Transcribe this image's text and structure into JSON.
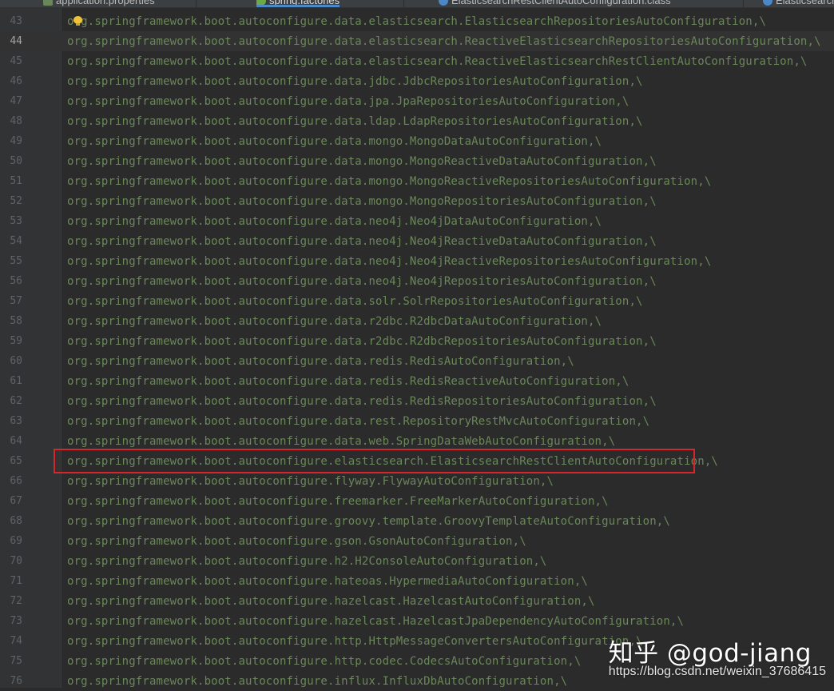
{
  "tabs": [
    {
      "label": "application.properties",
      "icon": "properties-file-icon",
      "active": false
    },
    {
      "label": "spring.factories",
      "icon": "spring-file-icon",
      "active": true
    },
    {
      "label": "ElasticsearchRestClientAutoConfiguration.class",
      "icon": "class-file-icon",
      "active": false
    },
    {
      "label": "Elasticsearch",
      "icon": "class-file-icon",
      "active": false
    }
  ],
  "editor": {
    "current_line": 44,
    "highlighted_line": 65,
    "lines": [
      {
        "n": "43",
        "text": "org.springframework.boot.autoconfigure.data.elasticsearch.ElasticsearchRepositoriesAutoConfiguration,\\"
      },
      {
        "n": "44",
        "text": "org.springframework.boot.autoconfigure.data.elasticsearch.ReactiveElasticsearchRepositoriesAutoConfiguration,\\"
      },
      {
        "n": "45",
        "text": "org.springframework.boot.autoconfigure.data.elasticsearch.ReactiveElasticsearchRestClientAutoConfiguration,\\"
      },
      {
        "n": "46",
        "text": "org.springframework.boot.autoconfigure.data.jdbc.JdbcRepositoriesAutoConfiguration,\\"
      },
      {
        "n": "47",
        "text": "org.springframework.boot.autoconfigure.data.jpa.JpaRepositoriesAutoConfiguration,\\"
      },
      {
        "n": "48",
        "text": "org.springframework.boot.autoconfigure.data.ldap.LdapRepositoriesAutoConfiguration,\\"
      },
      {
        "n": "49",
        "text": "org.springframework.boot.autoconfigure.data.mongo.MongoDataAutoConfiguration,\\"
      },
      {
        "n": "50",
        "text": "org.springframework.boot.autoconfigure.data.mongo.MongoReactiveDataAutoConfiguration,\\"
      },
      {
        "n": "51",
        "text": "org.springframework.boot.autoconfigure.data.mongo.MongoReactiveRepositoriesAutoConfiguration,\\"
      },
      {
        "n": "52",
        "text": "org.springframework.boot.autoconfigure.data.mongo.MongoRepositoriesAutoConfiguration,\\"
      },
      {
        "n": "53",
        "text": "org.springframework.boot.autoconfigure.data.neo4j.Neo4jDataAutoConfiguration,\\"
      },
      {
        "n": "54",
        "text": "org.springframework.boot.autoconfigure.data.neo4j.Neo4jReactiveDataAutoConfiguration,\\"
      },
      {
        "n": "55",
        "text": "org.springframework.boot.autoconfigure.data.neo4j.Neo4jReactiveRepositoriesAutoConfiguration,\\"
      },
      {
        "n": "56",
        "text": "org.springframework.boot.autoconfigure.data.neo4j.Neo4jRepositoriesAutoConfiguration,\\"
      },
      {
        "n": "57",
        "text": "org.springframework.boot.autoconfigure.data.solr.SolrRepositoriesAutoConfiguration,\\"
      },
      {
        "n": "58",
        "text": "org.springframework.boot.autoconfigure.data.r2dbc.R2dbcDataAutoConfiguration,\\"
      },
      {
        "n": "59",
        "text": "org.springframework.boot.autoconfigure.data.r2dbc.R2dbcRepositoriesAutoConfiguration,\\"
      },
      {
        "n": "60",
        "text": "org.springframework.boot.autoconfigure.data.redis.RedisAutoConfiguration,\\"
      },
      {
        "n": "61",
        "text": "org.springframework.boot.autoconfigure.data.redis.RedisReactiveAutoConfiguration,\\"
      },
      {
        "n": "62",
        "text": "org.springframework.boot.autoconfigure.data.redis.RedisRepositoriesAutoConfiguration,\\"
      },
      {
        "n": "63",
        "text": "org.springframework.boot.autoconfigure.data.rest.RepositoryRestMvcAutoConfiguration,\\"
      },
      {
        "n": "64",
        "text": "org.springframework.boot.autoconfigure.data.web.SpringDataWebAutoConfiguration,\\"
      },
      {
        "n": "65",
        "text": "org.springframework.boot.autoconfigure.elasticsearch.ElasticsearchRestClientAutoConfiguration,\\"
      },
      {
        "n": "66",
        "text": "org.springframework.boot.autoconfigure.flyway.FlywayAutoConfiguration,\\"
      },
      {
        "n": "67",
        "text": "org.springframework.boot.autoconfigure.freemarker.FreeMarkerAutoConfiguration,\\"
      },
      {
        "n": "68",
        "text": "org.springframework.boot.autoconfigure.groovy.template.GroovyTemplateAutoConfiguration,\\"
      },
      {
        "n": "69",
        "text": "org.springframework.boot.autoconfigure.gson.GsonAutoConfiguration,\\"
      },
      {
        "n": "70",
        "text": "org.springframework.boot.autoconfigure.h2.H2ConsoleAutoConfiguration,\\"
      },
      {
        "n": "71",
        "text": "org.springframework.boot.autoconfigure.hateoas.HypermediaAutoConfiguration,\\"
      },
      {
        "n": "72",
        "text": "org.springframework.boot.autoconfigure.hazelcast.HazelcastAutoConfiguration,\\"
      },
      {
        "n": "73",
        "text": "org.springframework.boot.autoconfigure.hazelcast.HazelcastJpaDependencyAutoConfiguration,\\"
      },
      {
        "n": "74",
        "text": "org.springframework.boot.autoconfigure.http.HttpMessageConvertersAutoConfiguration,\\"
      },
      {
        "n": "75",
        "text": "org.springframework.boot.autoconfigure.http.codec.CodecsAutoConfiguration,\\"
      },
      {
        "n": "76",
        "text": "org.springframework.boot.autoconfigure.influx.InfluxDbAutoConfiguration,\\"
      }
    ]
  },
  "watermark": {
    "brand": "知乎 @god-jiang",
    "url": "https://blog.csdn.net/weixin_37686415"
  },
  "colors": {
    "editor_bg": "#2b2b2b",
    "gutter_bg": "#313335",
    "string_green": "#6a8759",
    "line_number": "#606366",
    "highlight_box": "#d6262b"
  }
}
